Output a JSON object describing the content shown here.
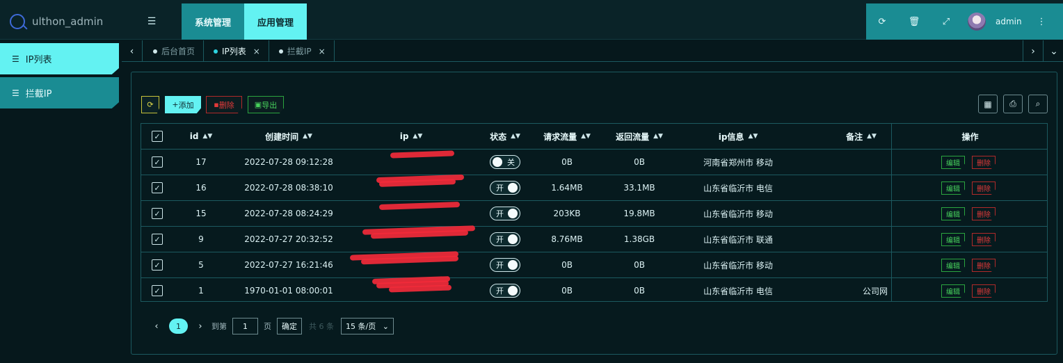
{
  "app": {
    "logo_text": "ulthon_admin"
  },
  "topnav": [
    {
      "label": "系统管理",
      "active": false
    },
    {
      "label": "应用管理",
      "active": true
    }
  ],
  "header_tools": {
    "user_name": "admin",
    "icons": [
      "refresh-icon",
      "trash-icon",
      "fullscreen-icon"
    ]
  },
  "sidebar": {
    "items": [
      {
        "label": "IP列表",
        "active": true
      },
      {
        "label": "拦截IP",
        "active": false
      }
    ]
  },
  "tabs": [
    {
      "label": "后台首页",
      "active": false,
      "closable": false
    },
    {
      "label": "IP列表",
      "active": true,
      "closable": true
    },
    {
      "label": "拦截IP",
      "active": false,
      "closable": true
    }
  ],
  "toolbar": {
    "add_label": "添加",
    "delete_label": "删除",
    "export_label": "导出"
  },
  "table": {
    "columns": [
      "id",
      "创建时间",
      "ip",
      "状态",
      "请求流量",
      "返回流量",
      "ip信息",
      "备注",
      "操作"
    ],
    "rows": [
      {
        "id": "17",
        "created": "2022-07-28 09:12:28",
        "status": "关",
        "req": "0B",
        "resp": "0B",
        "ipinfo": "河南省郑州市 移动",
        "note": ""
      },
      {
        "id": "16",
        "created": "2022-07-28 08:38:10",
        "status": "开",
        "req": "1.64MB",
        "resp": "33.1MB",
        "ipinfo": "山东省临沂市 电信",
        "note": ""
      },
      {
        "id": "15",
        "created": "2022-07-28 08:24:29",
        "status": "开",
        "req": "203KB",
        "resp": "19.8MB",
        "ipinfo": "山东省临沂市 移动",
        "note": ""
      },
      {
        "id": "9",
        "created": "2022-07-27 20:32:52",
        "status": "开",
        "req": "8.76MB",
        "resp": "1.38GB",
        "ipinfo": "山东省临沂市 联通",
        "note": ""
      },
      {
        "id": "5",
        "created": "2022-07-27 16:21:46",
        "status": "开",
        "req": "0B",
        "resp": "0B",
        "ipinfo": "山东省临沂市 移动",
        "note": ""
      },
      {
        "id": "1",
        "created": "1970-01-01 08:00:01",
        "status": "开",
        "req": "0B",
        "resp": "0B",
        "ipinfo": "山东省临沂市 电信",
        "note": "公司网"
      }
    ],
    "edit_label": "编辑",
    "delete_label": "删除"
  },
  "pager": {
    "current_page": "1",
    "goto_label": "到第",
    "goto_value": "1",
    "page_label": "页",
    "confirm_label": "确定",
    "total_label": "共 6 条",
    "page_size": "15 条/页"
  },
  "colors": {
    "accent": "#63f2f2",
    "primary": "#1a8c93",
    "danger": "#e23a3a",
    "success": "#47d05c",
    "background": "#06181c"
  }
}
